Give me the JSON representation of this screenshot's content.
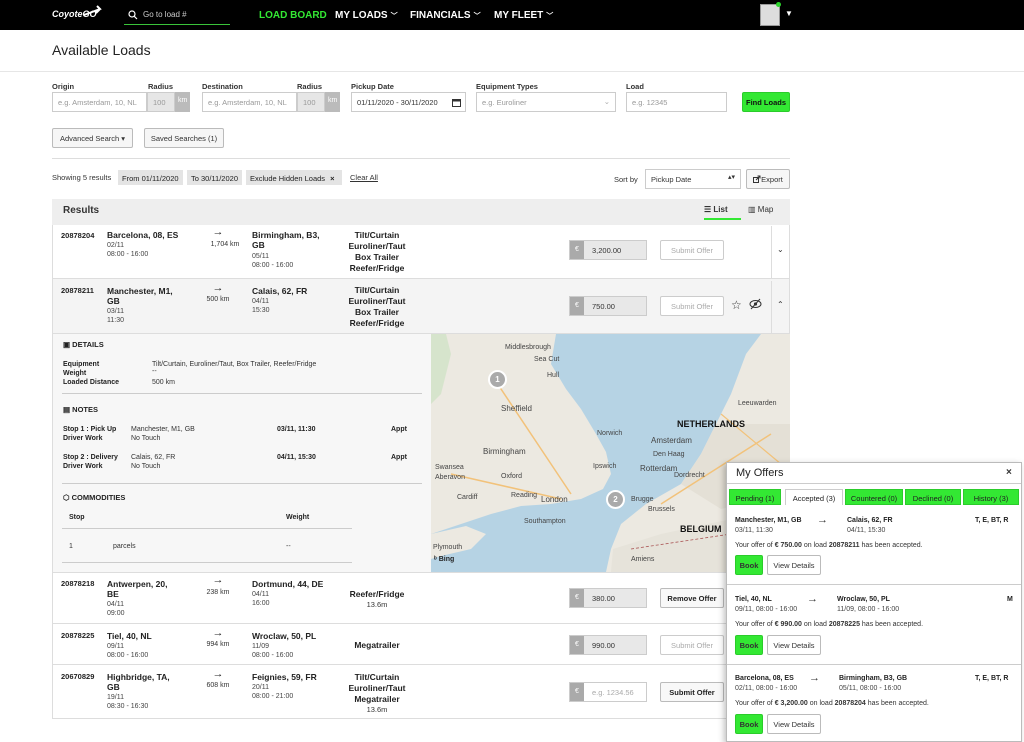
{
  "nav": {
    "logo": "CoyoteGO",
    "search_placeholder": "Go to load #",
    "links": [
      "LOAD BOARD",
      "MY LOADS",
      "FINANCIALS",
      "MY FLEET"
    ]
  },
  "page_title": "Available Loads",
  "search": {
    "origin_label": "Origin",
    "origin_placeholder": "e.g. Amsterdam, 10, NL",
    "radius_label": "Radius",
    "radius_value": "100",
    "km": "km",
    "dest_label": "Destination",
    "dest_placeholder": "e.g. Amsterdam, 10, NL",
    "radius2_label": "Radius",
    "radius2_value": "100",
    "pickup_label": "Pickup Date",
    "pickup_value": "01/11/2020 - 30/11/2020",
    "equip_label": "Equipment Types",
    "equip_placeholder": "e.g. Euroliner",
    "load_label": "Load",
    "load_placeholder": "e.g. 12345",
    "find": "Find Loads",
    "advanced": "Advanced Search ▾",
    "saved": "Saved Searches (1)"
  },
  "filters": {
    "showing": "Showing 5 results",
    "chips": [
      "From 01/11/2020",
      "To 30/11/2020",
      "Exclude Hidden Loads"
    ],
    "clear": "Clear All",
    "sort_label": "Sort by",
    "sort_value": "Pickup Date",
    "export": "Export"
  },
  "results": {
    "title": "Results",
    "list": "List",
    "map": "Map",
    "rows": [
      {
        "id": "20878204",
        "origin": "Barcelona, 08, ES",
        "o_date": "02/11",
        "o_time": "08:00 - 16:00",
        "dist": "1,704 km",
        "dest1": "Birmingham, B3,",
        "dest2": "GB",
        "d_date": "05/11",
        "d_time": "08:00 - 16:00",
        "equip": [
          "Tilt/Curtain",
          "Euroliner/Taut",
          "Box Trailer",
          "Reefer/Fridge"
        ],
        "price": "3,200.00",
        "action": "Submit Offer"
      },
      {
        "id": "20878211",
        "origin1": "Manchester, M1,",
        "origin2": "GB",
        "o_date": "03/11",
        "o_time": "11:30",
        "dist": "500 km",
        "dest": "Calais, 62, FR",
        "d_date": "04/11",
        "d_time": "15:30",
        "equip": [
          "Tilt/Curtain",
          "Euroliner/Taut",
          "Box Trailer",
          "Reefer/Fridge"
        ],
        "price": "750.00",
        "action": "Submit Offer"
      },
      {
        "id": "20878218",
        "origin1": "Antwerpen, 20,",
        "origin2": "BE",
        "o_date": "04/11",
        "o_time": "09:00",
        "dist": "238 km",
        "dest": "Dortmund, 44, DE",
        "d_date": "04/11",
        "d_time": "16:00",
        "equip": "Reefer/Fridge",
        "sub": "13.6m",
        "price": "380.00",
        "action": "Remove Offer"
      },
      {
        "id": "20878225",
        "origin": "Tiel, 40, NL",
        "o_date": "09/11",
        "o_time": "08:00 - 16:00",
        "dist": "994 km",
        "dest": "Wroclaw, 50, PL",
        "d_date": "11/09",
        "d_time": "08:00 - 16:00",
        "equip": "Megatrailer",
        "price": "990.00",
        "action": "Submit Offer"
      },
      {
        "id": "20670829",
        "origin1": "Highbridge, TA,",
        "origin2": "GB",
        "o_date": "19/11",
        "o_time": "08:30 - 16:30",
        "dist": "608 km",
        "dest": "Feignies, 59, FR",
        "d_date": "20/11",
        "d_time": "08:00 - 21:00",
        "equip": [
          "Tilt/Curtain",
          "Euroliner/Taut",
          "Megatrailer"
        ],
        "sub": "13.6m",
        "price_placeholder": "e.g. 1234.56",
        "action": "Submit Offer"
      }
    ]
  },
  "details": {
    "title": "DETAILS",
    "equipment_label": "Equipment",
    "equipment": "Tilt/Curtain, Euroliner/Taut, Box Trailer, Reefer/Fridge",
    "weight_label": "Weight",
    "weight": "--",
    "distance_label": "Loaded Distance",
    "distance": "500 km",
    "notes_title": "NOTES",
    "stop1_label": "Stop 1 : Pick Up",
    "stop1_city": "Manchester, M1, GB",
    "stop1_time": "03/11, 11:30",
    "stop1_appt": "Appt",
    "driver_label": "Driver Work",
    "no_touch": "No Touch",
    "stop2_label": "Stop 2 : Delivery",
    "stop2_city": "Calais, 62, FR",
    "stop2_time": "04/11, 15:30",
    "stop2_appt": "Appt",
    "commodities_title": "COMMODITIES",
    "col_stop": "Stop",
    "col_weight": "Weight",
    "c_stop": "1",
    "c_item": "parcels",
    "c_weight": "--"
  },
  "map": {
    "labels": [
      "Middlesbrough",
      "Sea Cut",
      "Hull",
      "Sheffield",
      "Birmingham",
      "Oxford",
      "London",
      "Swansea",
      "Aberavon",
      "Cardiff",
      "Reading",
      "Southampton",
      "Ipswich",
      "Plymouth",
      "Leeuwarden",
      "Amsterdam",
      "Den Haag",
      "Rotterdam",
      "Dordrecht",
      "Brugge",
      "Brussels",
      "Amiens",
      "Norwich"
    ],
    "countries": [
      "NETHERLANDS",
      "BELGIUM"
    ],
    "pins": [
      "1",
      "2"
    ],
    "bing": "Bing"
  },
  "offers": {
    "title": "My Offers",
    "close": "×",
    "tabs": [
      "Pending (1)",
      "Accepted (3)",
      "Countered (0)",
      "Declined (0)",
      "History (3)"
    ],
    "cards": [
      {
        "origin": "Manchester, M1, GB",
        "o_time": "03/11, 11:30",
        "dest": "Calais, 62, FR",
        "d_time": "04/11, 15:30",
        "equip": "T, E, BT, R",
        "msg_a": "Your offer of ",
        "amount": "€ 750.00",
        "msg_b": " on load ",
        "load": "20878211",
        "msg_c": " has been accepted."
      },
      {
        "origin": "Tiel, 40, NL",
        "o_time": "09/11, 08:00 - 16:00",
        "dest": "Wroclaw, 50, PL",
        "d_time": "11/09, 08:00 - 16:00",
        "equip": "M",
        "msg_a": "Your offer of ",
        "amount": "€ 990.00",
        "msg_b": " on load ",
        "load": "20878225",
        "msg_c": " has been accepted."
      },
      {
        "origin": "Barcelona, 08, ES",
        "o_time": "02/11, 08:00 - 16:00",
        "dest": "Birmingham, B3, GB",
        "d_time": "05/11, 08:00 - 16:00",
        "equip": "T, E, BT, R",
        "msg_a": "Your offer of ",
        "amount": "€ 3,200.00",
        "msg_b": " on load ",
        "load": "20878204",
        "msg_c": " has been accepted."
      }
    ],
    "book": "Book",
    "view": "View Details"
  },
  "colors": {
    "accent": "#33e833",
    "nav_bg": "#000000"
  }
}
